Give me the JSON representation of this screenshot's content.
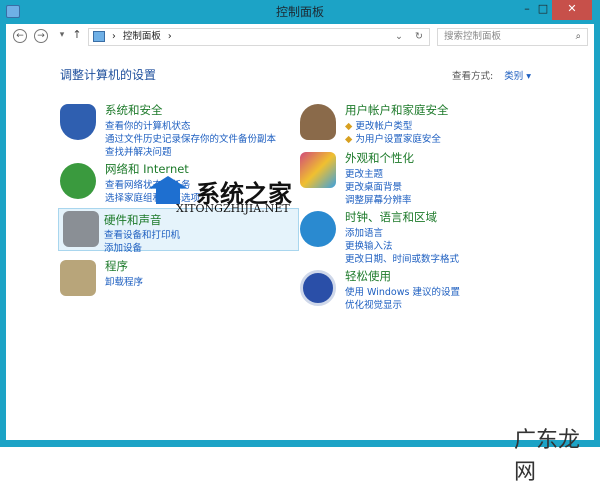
{
  "window": {
    "title": "控制面板",
    "minimize": "–",
    "maximize": "□",
    "close": "✕"
  },
  "toolbar": {
    "back": "←",
    "forward": "→",
    "recent": "▾",
    "up": "↑",
    "breadcrumb": [
      "控制面板"
    ],
    "sep": "›",
    "dropdown": "⌄",
    "refresh": "↻",
    "search_placeholder": "搜索控制面板",
    "search_icon": "⌕"
  },
  "main": {
    "heading": "调整计算机的设置",
    "view_label": "查看方式:",
    "view_value": "类别",
    "view_arrow": "▾"
  },
  "categories_left": [
    {
      "title": "系统和安全",
      "links": [
        "查看你的计算机状态",
        "通过文件历史记录保存你的文件备份副本",
        "查找并解决问题"
      ],
      "icon": "shield-icon",
      "color": "#2f5fb0"
    },
    {
      "title": "网络和 Internet",
      "links": [
        "查看网络状态和任务",
        "选择家庭组和共享选项"
      ],
      "icon": "network-globe-icon",
      "color": "#3a9a3e"
    },
    {
      "title": "硬件和声音",
      "links": [
        "查看设备和打印机",
        "添加设备"
      ],
      "icon": "printer-icon",
      "color": "#8a8f95"
    },
    {
      "title": "程序",
      "links": [
        "卸载程序"
      ],
      "icon": "programs-icon",
      "color": "#b8a57a"
    }
  ],
  "categories_right": [
    {
      "title": "用户帐户和家庭安全",
      "links": [
        "更改帐户类型",
        "为用户设置家庭安全"
      ],
      "icon": "users-icon",
      "color": "#8a6a4a"
    },
    {
      "title": "外观和个性化",
      "links": [
        "更改主题",
        "更改桌面背景",
        "调整屏幕分辨率"
      ],
      "icon": "personalize-icon",
      "color": "#d04a7a"
    },
    {
      "title": "时钟、语言和区域",
      "links": [
        "添加语言",
        "更换输入法",
        "更改日期、时间或数字格式"
      ],
      "icon": "clock-globe-icon",
      "color": "#2a8ad0"
    },
    {
      "title": "轻松使用",
      "links": [
        "使用 Windows 建议的设置",
        "优化视觉显示"
      ],
      "icon": "ease-of-access-icon",
      "color": "#2a4fa8"
    }
  ],
  "watermarks": {
    "site": "系统之家",
    "url": "XITONGZHIJIA.NET",
    "corner": "广东龙网"
  }
}
